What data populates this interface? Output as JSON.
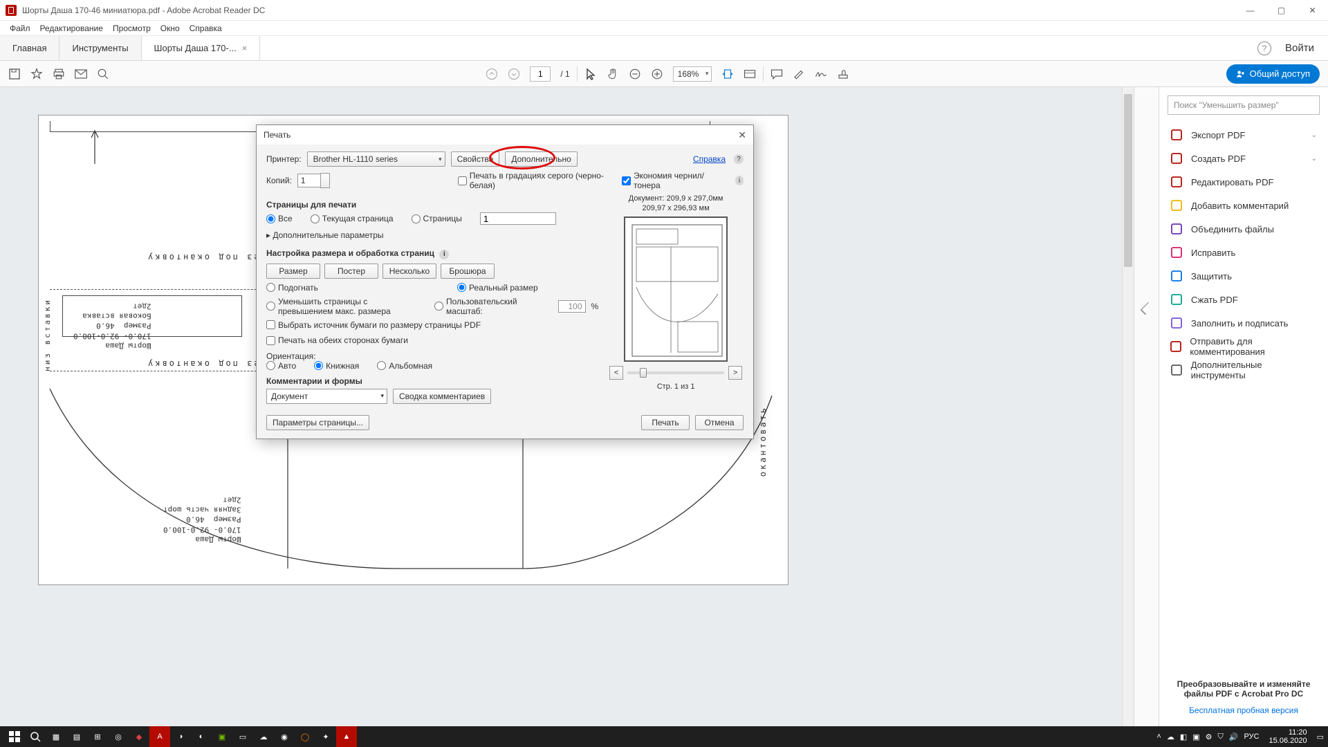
{
  "window": {
    "title": "Шорты Даша 170-46 миниатюра.pdf - Adobe Acrobat Reader DC"
  },
  "menu": {
    "file": "Файл",
    "edit": "Редактирование",
    "view": "Просмотр",
    "window": "Окно",
    "help": "Справка"
  },
  "tabs": {
    "home": "Главная",
    "tools": "Инструменты",
    "doc": "Шорты Даша 170-...",
    "close": "×"
  },
  "header": {
    "help": "?",
    "login": "Войти"
  },
  "toolbar": {
    "page": "1",
    "page_total": "/ 1",
    "zoom": "168%",
    "share": "Общий доступ"
  },
  "right_panel": {
    "search_placeholder": "Поиск \"Уменьшить размер\"",
    "items": [
      "Экспорт PDF",
      "Создать PDF",
      "Редактировать PDF",
      "Добавить комментарий",
      "Объединить файлы",
      "Исправить",
      "Защитить",
      "Сжать PDF",
      "Заполнить и подписать",
      "Отправить для комментирования",
      "Дополнительные инструменты"
    ],
    "icon_colors": [
      "#b30b00",
      "#b30b00",
      "#b30b00",
      "#f5b400",
      "#6b2fb3",
      "#d41a66",
      "#0071e3",
      "#00a090",
      "#7a4fdc",
      "#b30b00",
      "#555"
    ],
    "promo_bold": "Преобразовывайте и изменяйте файлы PDF с Acrobat Pro DC",
    "promo_link": "Бесплатная пробная версия"
  },
  "dialog": {
    "title": "Печать",
    "printer_label": "Принтер:",
    "printer_value": "Brother HL-1110 series",
    "properties": "Свойства",
    "advanced": "Дополнительно",
    "help": "Справка",
    "copies_label": "Копий:",
    "copies_value": "1",
    "grayscale": "Печать в градациях серого (черно-белая)",
    "ink_save": "Экономия чернил/тонера",
    "pages_section": "Страницы для печати",
    "radio_all": "Все",
    "radio_current": "Текущая страница",
    "radio_pages": "Страницы",
    "pages_input": "1",
    "more_params": "Дополнительные параметры",
    "size_section": "Настройка размера и обработка страниц",
    "seg_size": "Размер",
    "seg_poster": "Постер",
    "seg_multi": "Несколько",
    "seg_booklet": "Брошюра",
    "fit": "Подогнать",
    "real_size": "Реальный размер",
    "shrink": "Уменьшить страницы с превышением макс. размера",
    "custom_scale": "Пользовательский масштаб:",
    "scale_value": "100",
    "percent": "%",
    "paper_source": "Выбрать источник бумаги по размеру страницы PDF",
    "both_sides": "Печать на обеих сторонах бумаги",
    "orientation": "Ориентация:",
    "orient_auto": "Авто",
    "orient_portrait": "Книжная",
    "orient_landscape": "Альбомная",
    "comments_section": "Комментарии и формы",
    "comments_value": "Документ",
    "comments_summary": "Сводка комментариев",
    "doc_size": "Документ: 209,9 x 297,0мм",
    "paper_size": "209,97 x 296,93 мм",
    "page_of": "Стр. 1 из 1",
    "page_setup": "Параметры страницы...",
    "print": "Печать",
    "cancel": "Отмена",
    "prev": "<",
    "next": ">"
  },
  "taskbar": {
    "lang": "РУС",
    "time": "11:20",
    "date": "15.06.2020"
  }
}
